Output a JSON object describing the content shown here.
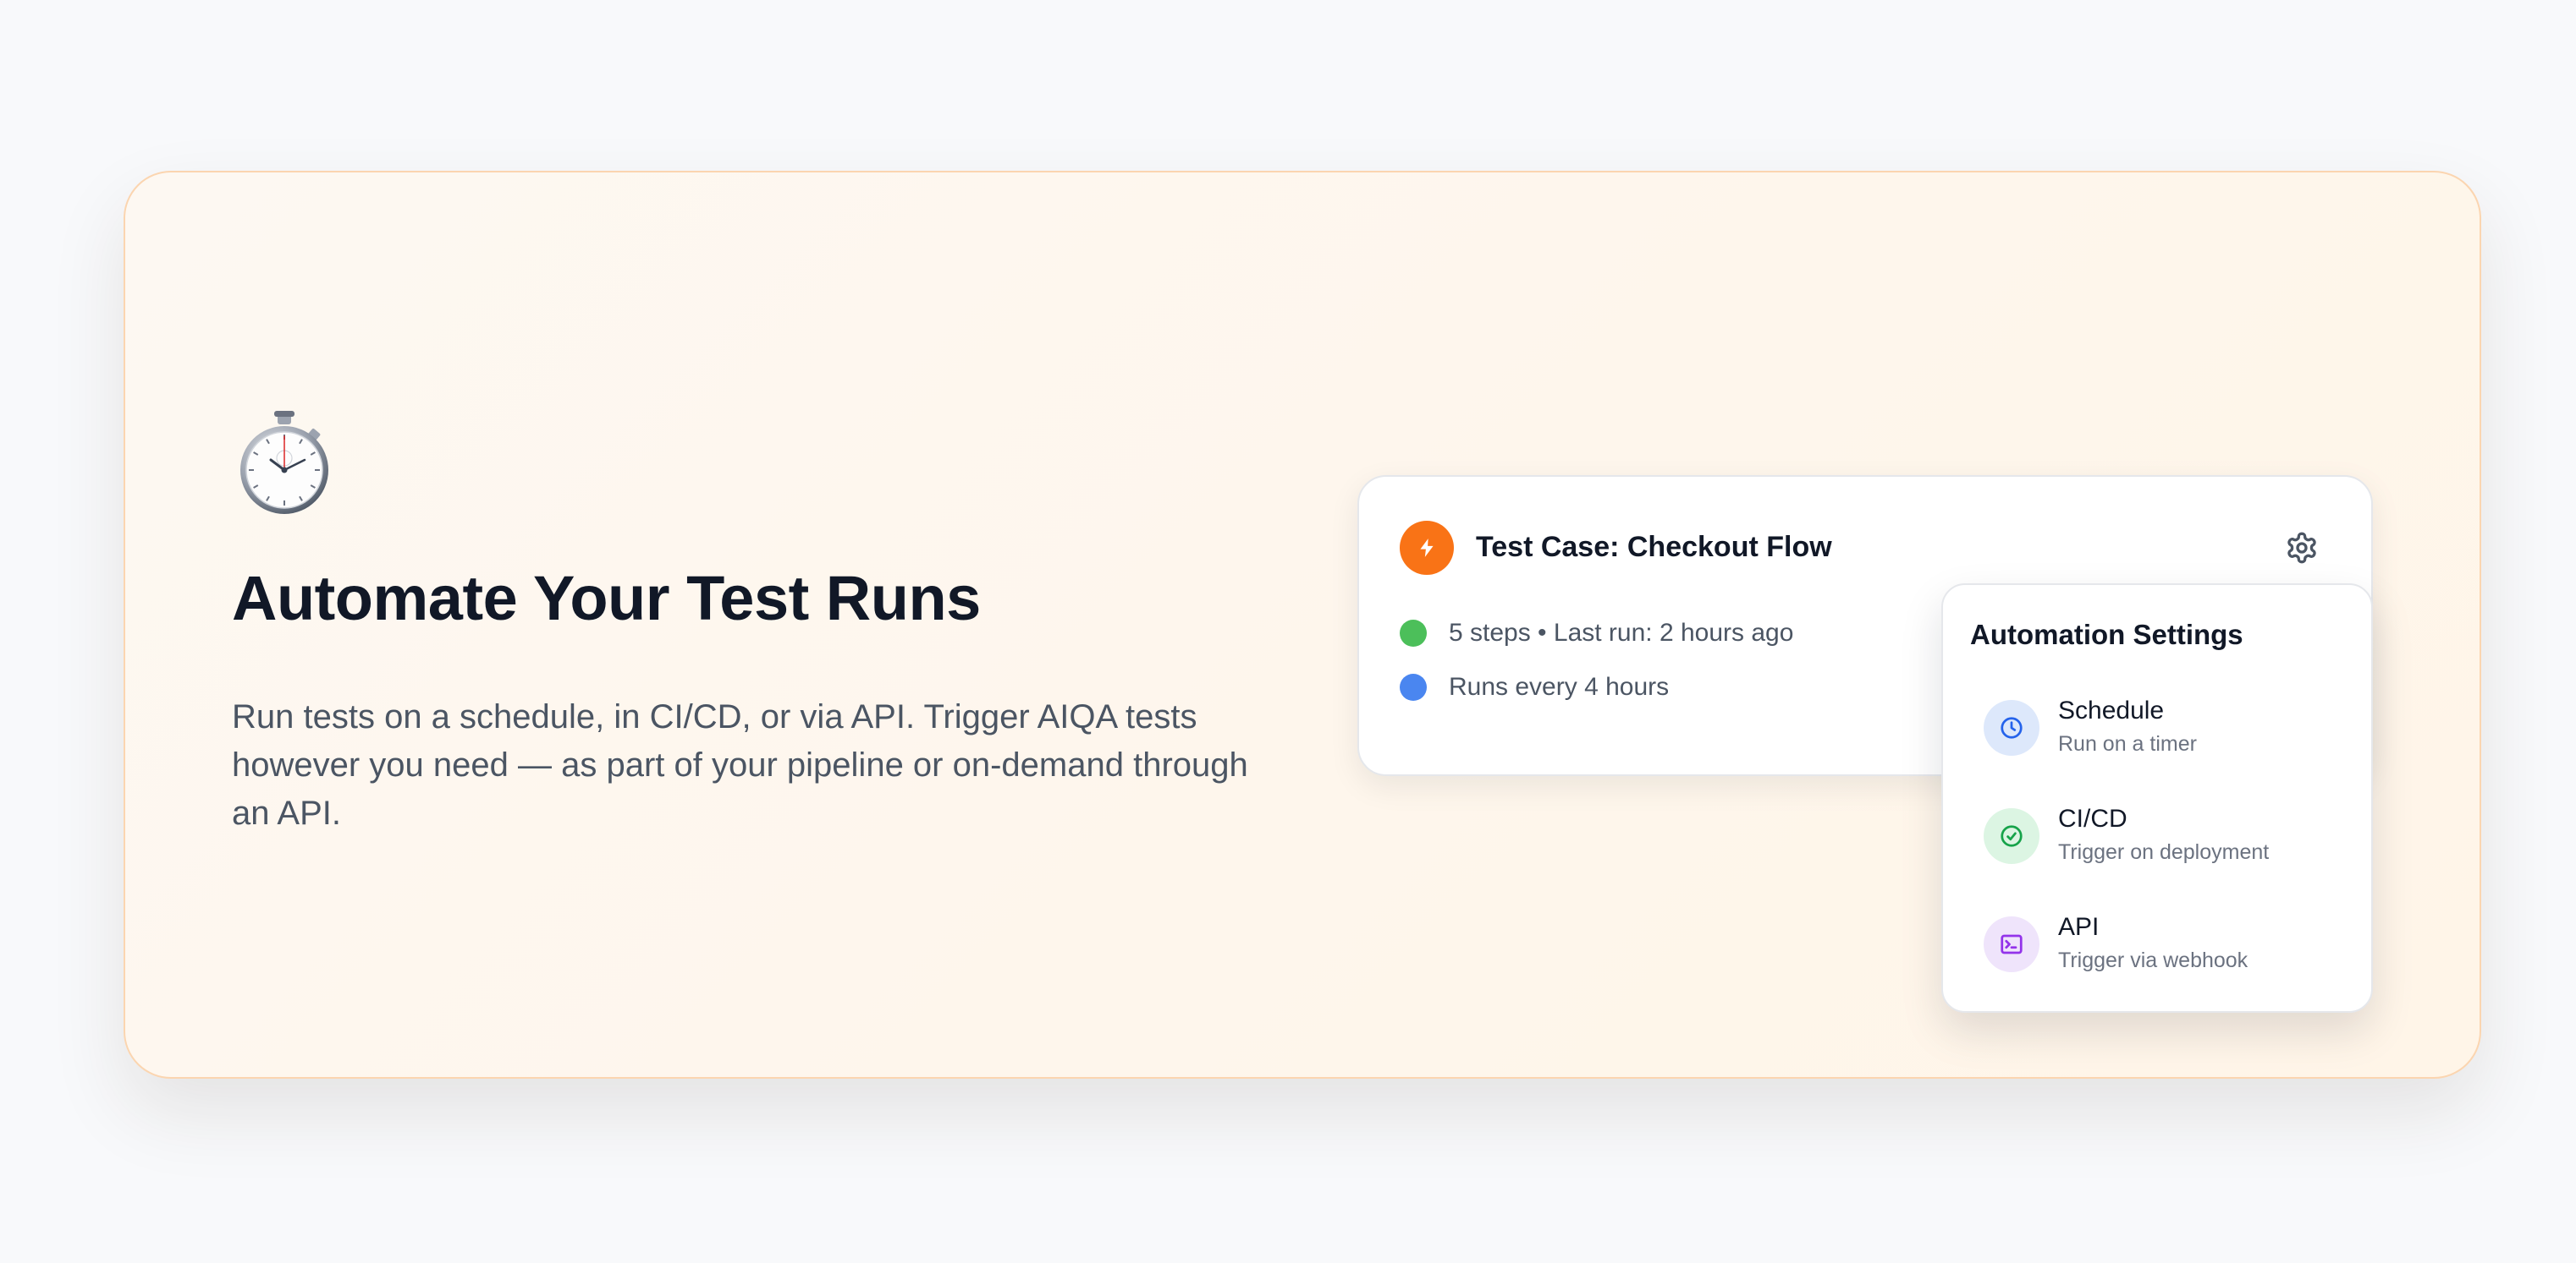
{
  "hero": {
    "headline": "Automate Your Test Runs",
    "description": "Run tests on a schedule, in CI/CD, or via API. Trigger AIQA tests however you need — as part of your pipeline or on-demand through an API.",
    "icon": "stopwatch-icon"
  },
  "test_card": {
    "title": "Test Case: Checkout Flow",
    "badge_icon": "lightning-bolt-icon",
    "settings_icon": "gear-icon",
    "meta": [
      {
        "text": "5 steps • Last run: 2 hours ago",
        "dot_color": "#4cbf5a"
      },
      {
        "text": "Runs every 4 hours",
        "dot_color": "#4a86f0"
      }
    ]
  },
  "settings_popover": {
    "title": "Automation Settings",
    "options": [
      {
        "label": "Schedule",
        "sublabel": "Run on a timer",
        "icon": "clock-icon",
        "icon_bg": "#dde8fb",
        "icon_color": "#2563eb"
      },
      {
        "label": "CI/CD",
        "sublabel": "Trigger on deployment",
        "icon": "check-circle-icon",
        "icon_bg": "#dcf5e3",
        "icon_color": "#16a34a"
      },
      {
        "label": "API",
        "sublabel": "Trigger via webhook",
        "icon": "terminal-icon",
        "icon_bg": "#efe4fb",
        "icon_color": "#9333ea"
      }
    ]
  },
  "colors": {
    "accent": "#f97316",
    "heading": "#111827",
    "body_text": "#4b5563",
    "card_border": "#fbd5b0"
  }
}
